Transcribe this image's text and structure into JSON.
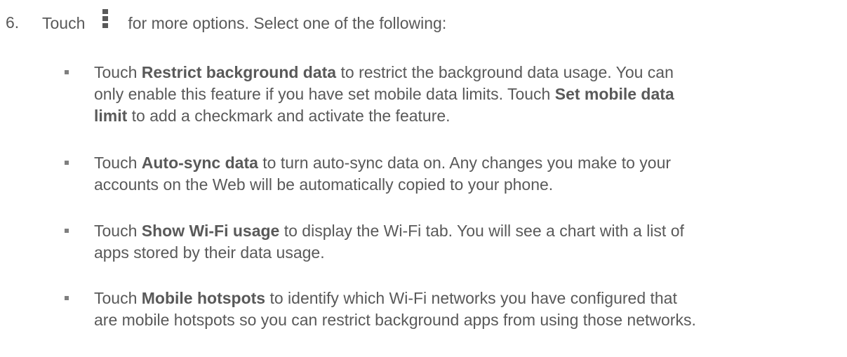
{
  "step": {
    "number": "6.",
    "before_icon": "Touch",
    "icon": "more-options-icon",
    "after_icon": "for more options. Select one of the following:"
  },
  "options": [
    {
      "lines": [
        {
          "parts": [
            {
              "text": "Touch ",
              "bold": false
            },
            {
              "text": "Restrict background data",
              "bold": true
            },
            {
              "text": " to restrict the background data usage. You can",
              "bold": false
            }
          ]
        },
        {
          "parts": [
            {
              "text": "only enable this feature if you have set mobile data limits. Touch ",
              "bold": false
            },
            {
              "text": "Set mobile data",
              "bold": true
            }
          ]
        },
        {
          "parts": [
            {
              "text": "limit",
              "bold": true
            },
            {
              "text": " to add a checkmark and activate the feature.",
              "bold": false
            }
          ]
        }
      ]
    },
    {
      "lines": [
        {
          "parts": [
            {
              "text": "Touch ",
              "bold": false
            },
            {
              "text": "Auto-sync data",
              "bold": true
            },
            {
              "text": " to turn auto-sync data on. Any changes you make to your",
              "bold": false
            }
          ]
        },
        {
          "parts": [
            {
              "text": "accounts on the Web will be automatically copied to your phone.",
              "bold": false
            }
          ]
        }
      ]
    },
    {
      "lines": [
        {
          "parts": [
            {
              "text": "Touch ",
              "bold": false
            },
            {
              "text": "Show Wi-Fi usage",
              "bold": true
            },
            {
              "text": " to display the Wi-Fi tab. You will see a chart with a list of",
              "bold": false
            }
          ]
        },
        {
          "parts": [
            {
              "text": "apps stored by their data usage.",
              "bold": false
            }
          ]
        }
      ]
    },
    {
      "lines": [
        {
          "parts": [
            {
              "text": "Touch ",
              "bold": false
            },
            {
              "text": "Mobile hotspots",
              "bold": true
            },
            {
              "text": " to identify which Wi-Fi networks you have configured that",
              "bold": false
            }
          ]
        },
        {
          "parts": [
            {
              "text": "are mobile hotspots so you can restrict background apps from using those networks.",
              "bold": false
            }
          ]
        }
      ]
    }
  ]
}
